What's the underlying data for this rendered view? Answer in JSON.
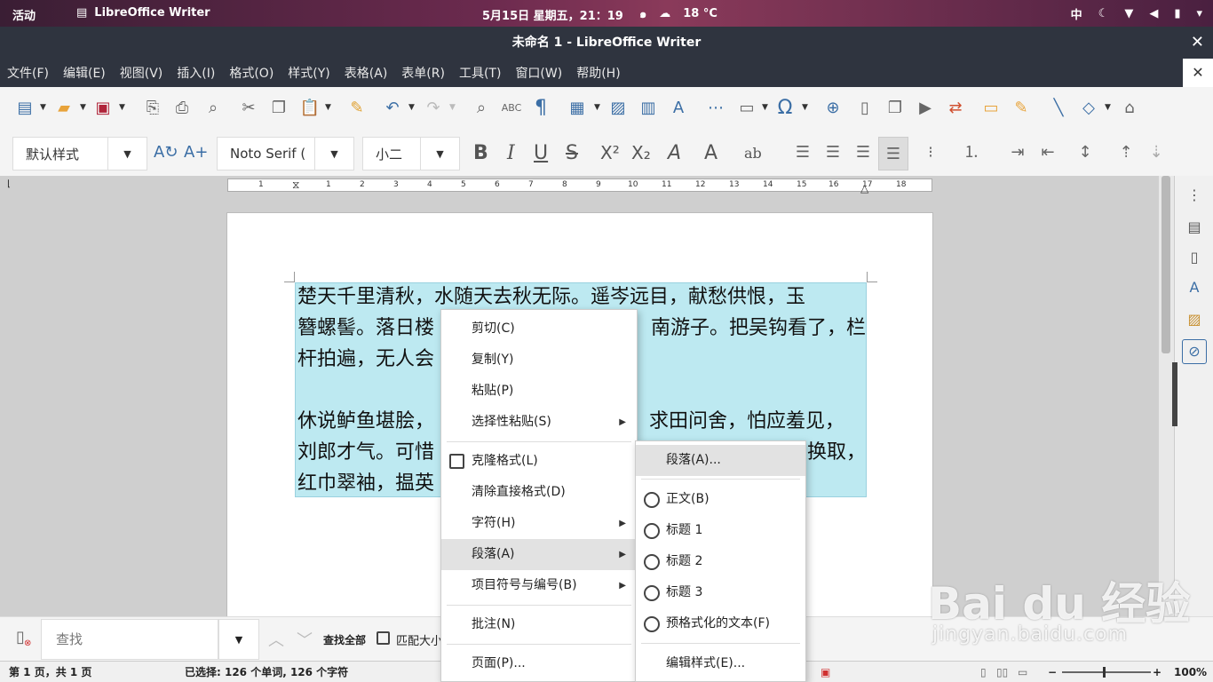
{
  "topbar": {
    "activities": "活动",
    "app_name": "LibreOffice Writer",
    "datetime": "5月15日 星期五，21：19",
    "temperature": "18 °C",
    "input_method": "中"
  },
  "window": {
    "title": "未命名 1 - LibreOffice Writer"
  },
  "menubar": {
    "items": [
      "文件(F)",
      "编辑(E)",
      "视图(V)",
      "插入(I)",
      "格式(O)",
      "样式(Y)",
      "表格(A)",
      "表单(R)",
      "工具(T)",
      "窗口(W)",
      "帮助(H)"
    ]
  },
  "formatting": {
    "paragraph_style": "默认样式",
    "font_name": "Noto Serif (",
    "font_size": "小二",
    "bold": "B",
    "italic": "I",
    "underline": "U",
    "strikethrough": "S",
    "superscript": "X²",
    "subscript": "X₂",
    "font_color": "#d01e1e",
    "highlight_color": "#ffee00"
  },
  "ruler": {
    "numbers": [
      "1",
      "1",
      "2",
      "3",
      "4",
      "5",
      "6",
      "7",
      "8",
      "9",
      "10",
      "11",
      "12",
      "13",
      "14",
      "15",
      "16",
      "17",
      "18"
    ]
  },
  "document": {
    "lines": [
      "楚天千里清秋，水随天去秋无际。遥岑远目，献愁供恨，玉",
      "簪螺髻。落日楼",
      "南游子。把吴钩看了，栏",
      "杆拍遍，无人会",
      "休说鲈鱼堪脍，",
      "求田问舍，怕应羞见，",
      "刘郎才气。可惜",
      "换取，",
      "红巾翠袖，揾英"
    ]
  },
  "context_menu": {
    "cut": "剪切(C)",
    "copy": "复制(Y)",
    "paste": "粘贴(P)",
    "paste_special": "选择性粘贴(S)",
    "clone_format": "克隆格式(L)",
    "clear_direct_format": "清除直接格式(D)",
    "character": "字符(H)",
    "paragraph": "段落(A)",
    "bullets_numbering": "项目符号与编号(B)",
    "comment": "批注(N)",
    "page": "页面(P)..."
  },
  "submenu": {
    "paragraph_dialog": "段落(A)...",
    "body_text": "正文(B)",
    "heading1": "标题 1",
    "heading2": "标题 2",
    "heading3": "标题 3",
    "preformatted": "预格式化的文本(F)",
    "edit_style": "编辑样式(E)..."
  },
  "findbar": {
    "placeholder": "查找",
    "find_all": "查找全部",
    "match_case": "匹配大小"
  },
  "statusbar": {
    "page": "第 1 页，共 1 页",
    "selection": "已选择: 126 个单词, 126 个字符",
    "zoom": "100%"
  },
  "watermark": {
    "logo": "Bai du 经验",
    "url": "jingyan.baidu.com"
  }
}
